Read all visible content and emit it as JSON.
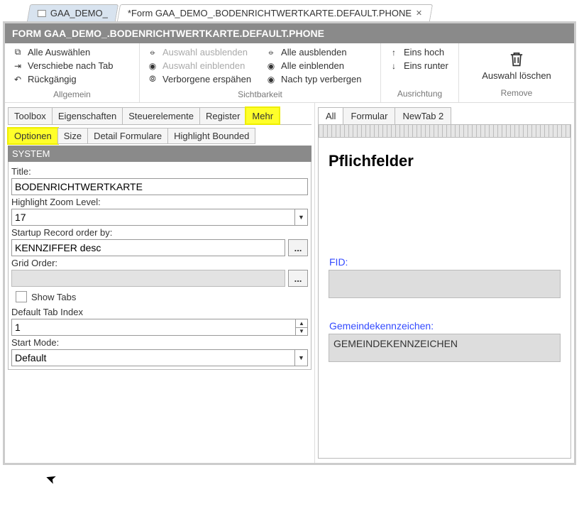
{
  "doc_tabs": {
    "inactive": "GAA_DEMO_",
    "active": "*Form GAA_DEMO_.BODENRICHTWERTKARTE.DEFAULT.PHONE"
  },
  "form_header": "FORM GAA_DEMO_.BODENRICHTWERTKARTE.DEFAULT.PHONE",
  "ribbon": {
    "allgemein": {
      "label": "Allgemein",
      "alle_auswaehlen": "Alle Auswählen",
      "verschiebe_nach_tab": "Verschiebe nach Tab",
      "rueckgaengig": "Rückgängig"
    },
    "sichtbarkeit": {
      "label": "Sichtbarkeit",
      "auswahl_ausblenden": "Auswahl ausblenden",
      "auswahl_einblenden": "Auswahl einblenden",
      "verborgene_erspaehen": "Verborgene erspähen",
      "alle_ausblenden": "Alle ausblenden",
      "alle_einblenden": "Alle einblenden",
      "nach_typ_verbergen": "Nach typ verbergen"
    },
    "ausrichtung": {
      "label": "Ausrichtung",
      "eins_hoch": "Eins hoch",
      "eins_runter": "Eins runter"
    },
    "remove": {
      "label": "Remove",
      "auswahl_loeschen": "Auswahl löschen"
    }
  },
  "left_tabs1": {
    "toolbox": "Toolbox",
    "eigenschaften": "Eigenschaften",
    "steuerelemente": "Steuerelemente",
    "register": "Register",
    "mehr": "Mehr"
  },
  "left_tabs2": {
    "optionen": "Optionen",
    "size": "Size",
    "detail_formulare": "Detail Formulare",
    "highlight_bounded": "Highlight Bounded"
  },
  "system_panel": {
    "header": "SYSTEM",
    "title_label": "Title:",
    "title_value": "BODENRICHTWERTKARTE",
    "hzl_label": "Highlight Zoom Level:",
    "hzl_value": "17",
    "startup_label": "Startup Record order by:",
    "startup_value": "KENNZIFFER desc",
    "grid_label": "Grid Order:",
    "grid_value": "",
    "show_tabs_label": "Show Tabs",
    "dti_label": "Default Tab Index",
    "dti_value": "1",
    "start_mode_label": "Start Mode:",
    "start_mode_value": "Default",
    "ellipsis": "..."
  },
  "right_tabs": {
    "all": "All",
    "formular": "Formular",
    "newtab2": "NewTab 2"
  },
  "preview": {
    "heading": "Pflichfelder",
    "fid_label": "FID:",
    "gk_label": "Gemeindekennzeichen:",
    "gk_value": "GEMEINDEKENNZEICHEN"
  }
}
